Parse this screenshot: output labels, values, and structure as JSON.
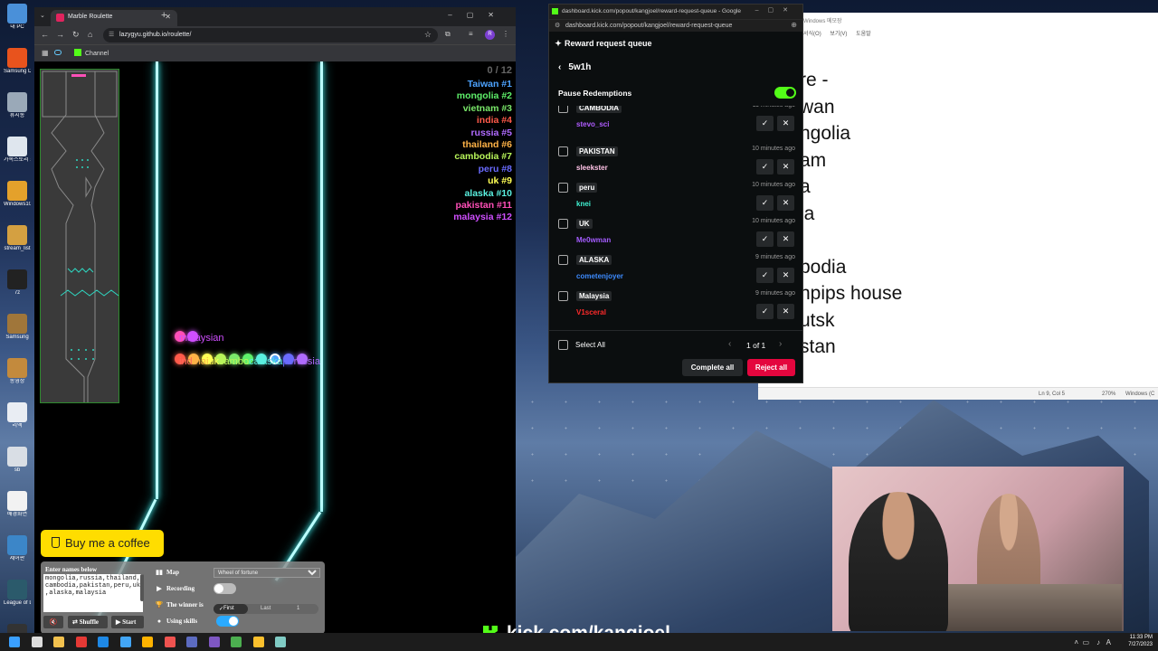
{
  "desktop": {
    "icons": [
      {
        "label": "내 PC",
        "color": "#4a90d9"
      },
      {
        "label": "Samsung DeX",
        "color": "#e8531d"
      },
      {
        "label": "휴지통",
        "color": "#9aa9b8"
      },
      {
        "label": "가족스토리 조이 txt",
        "color": "#dfe6ee"
      },
      {
        "label": "Windows10",
        "color": "#e4a12b"
      },
      {
        "label": "stream_list",
        "color": "#d4a041"
      },
      {
        "label": "7z",
        "color": "#222222"
      },
      {
        "label": "Samsung",
        "color": "#a0763a"
      },
      {
        "label": "동영상",
        "color": "#c38a3d"
      },
      {
        "label": "리액",
        "color": "#e9edf3"
      },
      {
        "label": "sb",
        "color": "#d9dee5"
      },
      {
        "label": "배경화면",
        "color": "#f2f2f2"
      },
      {
        "label": "제어판",
        "color": "#3c86c8"
      },
      {
        "label": "League of Legends",
        "color": "#2b5a6b"
      },
      {
        "label": "OBS Studio",
        "color": "#333333"
      }
    ]
  },
  "notepad": {
    "title": "Windows 메모장",
    "menu": [
      "서식(O)",
      "보기(V)",
      "도움말"
    ],
    "lines": [
      "re -",
      "wan",
      "ngolia",
      "am",
      "a",
      "ia",
      "",
      "bodia",
      "npips house",
      "utsk",
      "stan"
    ],
    "status_position": "Ln 9, Col 5",
    "status_zoom": "270%",
    "status_eol": "Windows (C"
  },
  "browser": {
    "tab_title": "Marble Roulette",
    "url": "lazygyu.github.io/roulette/",
    "bookmark": "Channel",
    "profile_initial": "R"
  },
  "game": {
    "counter": "0 / 12",
    "rankings": [
      {
        "label": "Taiwan #1",
        "color": "#4da3ff"
      },
      {
        "label": "mongolia #2",
        "color": "#5ef06a"
      },
      {
        "label": "vietnam #3",
        "color": "#7ae86a"
      },
      {
        "label": "india #4",
        "color": "#ff5a4a"
      },
      {
        "label": "russia #5",
        "color": "#b06bff"
      },
      {
        "label": "thailand #6",
        "color": "#ffb347"
      },
      {
        "label": "cambodia #7",
        "color": "#b8f55a"
      },
      {
        "label": "peru #8",
        "color": "#6a6bff"
      },
      {
        "label": "uk #9",
        "color": "#ffff55"
      },
      {
        "label": "alaska #10",
        "color": "#5af0e0"
      },
      {
        "label": "pakistan #11",
        "color": "#ff4fb8"
      },
      {
        "label": "malaysia #12",
        "color": "#d04fff"
      }
    ],
    "marble_labels": {
      "top": "malaysian",
      "bottom_parts": [
        {
          "text": "ind",
          "color": "#ff6a5a"
        },
        {
          "text": "thai",
          "color": "#ffb347"
        },
        {
          "text": "uk",
          "color": "#ffff55"
        },
        {
          "text": "cambo",
          "color": "#b8f55a"
        },
        {
          "text": "calaska",
          "color": "#5af0e0"
        },
        {
          "text": "pe",
          "color": "#6a6bff"
        },
        {
          "text": "russia",
          "color": "#b06bff"
        }
      ]
    },
    "coffee_button": "Buy me a coffee",
    "controls": {
      "names_label": "Enter names below",
      "names_value": "mongolia,russia,thailand,cambodia,pakistan,peru,uk,alaska,malaysia",
      "map_label": "Map",
      "map_value": "Wheel of fortune",
      "recording_label": "Recording",
      "recording_on": false,
      "winner_label": "The winner is",
      "winner_first": "First",
      "winner_last": "Last",
      "winner_last_value": "1",
      "skills_label": "Using skills",
      "skills_on": true,
      "shuffle_label": "Shuffle",
      "start_label": "Start"
    }
  },
  "kick_popup": {
    "window_title": "dashboard.kick.com/popout/kangjoel/reward-request-queue - Google C...",
    "url": "dashboard.kick.com/popout/kangjoel/reward-request-queue",
    "header": "Reward request queue",
    "reward_name": "5w1h",
    "pause_label": "Pause Redemptions",
    "pause_on": true,
    "requests": [
      {
        "title": "CAMBODIA",
        "user": "stevo_sci",
        "user_color": "#b05cff",
        "time": "11 minutes ago"
      },
      {
        "title": "PAKISTAN",
        "user": "sleekster",
        "user_color": "#ffc2e6",
        "time": "10 minutes ago"
      },
      {
        "title": "peru",
        "user": "knei",
        "user_color": "#3ff0d0",
        "time": "10 minutes ago"
      },
      {
        "title": "UK",
        "user": "Me0wman",
        "user_color": "#a45cff",
        "time": "10 minutes ago"
      },
      {
        "title": "ALASKA",
        "user": "cometenjoyer",
        "user_color": "#3d8bff",
        "time": "9 minutes ago"
      },
      {
        "title": "Malaysia",
        "user": "V1sceral",
        "user_color": "#ff2a2a",
        "time": "9 minutes ago"
      }
    ],
    "select_all": "Select All",
    "pagination": "1 of 1",
    "complete_all": "Complete all",
    "reject_all": "Reject all"
  },
  "overlay": {
    "kick_url": "kick.com/kangjoel"
  },
  "taskbar": {
    "time": "11:33 PM",
    "date": "7/27/2023",
    "icons": [
      {
        "name": "windows",
        "color": "#3aa0ff"
      },
      {
        "name": "search",
        "color": "#dddddd"
      },
      {
        "name": "files",
        "color": "#f2c14e"
      },
      {
        "name": "app1",
        "color": "#e53935"
      },
      {
        "name": "app2",
        "color": "#1e88e5"
      },
      {
        "name": "app3",
        "color": "#42a5f5"
      },
      {
        "name": "app4",
        "color": "#ffb300"
      },
      {
        "name": "app5",
        "color": "#ef5350"
      },
      {
        "name": "app6",
        "color": "#5c6bc0"
      },
      {
        "name": "app7",
        "color": "#7e57c2"
      },
      {
        "name": "chrome",
        "color": "#4caf50"
      },
      {
        "name": "chrome2",
        "color": "#fbc02d"
      },
      {
        "name": "app8",
        "color": "#80cbc4"
      }
    ]
  }
}
